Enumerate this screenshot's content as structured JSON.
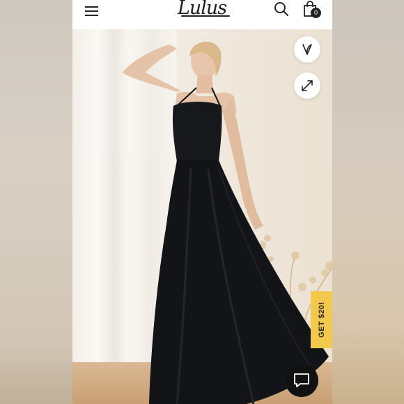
{
  "header": {
    "logo_text": "Lulus",
    "cart_count": "0",
    "icons": [
      "menu-icon",
      "search-icon",
      "shopping-bag-icon"
    ]
  },
  "product_image": {
    "actions": [
      "heart-icon",
      "expand-icon"
    ]
  },
  "promo": {
    "label": "GET $20!",
    "color": "#f2c94c"
  },
  "chat": {
    "icon": "chat-bubble-icon"
  }
}
